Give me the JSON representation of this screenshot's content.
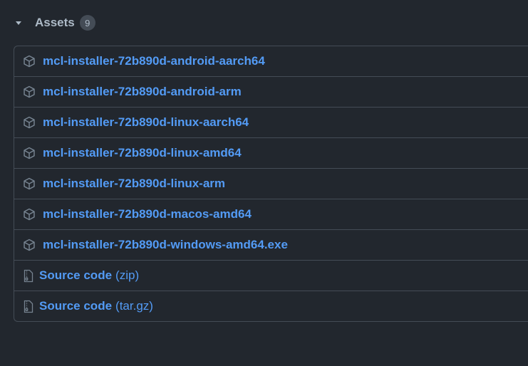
{
  "assets": {
    "title": "Assets",
    "count": "9",
    "items": [
      {
        "label": "mcl-installer-72b890d-android-aarch64",
        "icon": "package-icon"
      },
      {
        "label": "mcl-installer-72b890d-android-arm",
        "icon": "package-icon"
      },
      {
        "label": "mcl-installer-72b890d-linux-aarch64",
        "icon": "package-icon"
      },
      {
        "label": "mcl-installer-72b890d-linux-amd64",
        "icon": "package-icon"
      },
      {
        "label": "mcl-installer-72b890d-linux-arm",
        "icon": "package-icon"
      },
      {
        "label": "mcl-installer-72b890d-macos-amd64",
        "icon": "package-icon"
      },
      {
        "label": "mcl-installer-72b890d-windows-amd64.exe",
        "icon": "package-icon"
      }
    ],
    "source": [
      {
        "label": "Source code",
        "suffix": "(zip)",
        "icon": "file-zip-icon"
      },
      {
        "label": "Source code",
        "suffix": "(tar.gz)",
        "icon": "file-zip-icon"
      }
    ]
  },
  "colors": {
    "background": "#22272e",
    "border": "#444c56",
    "link": "#539bf5",
    "text": "#adbac7"
  }
}
